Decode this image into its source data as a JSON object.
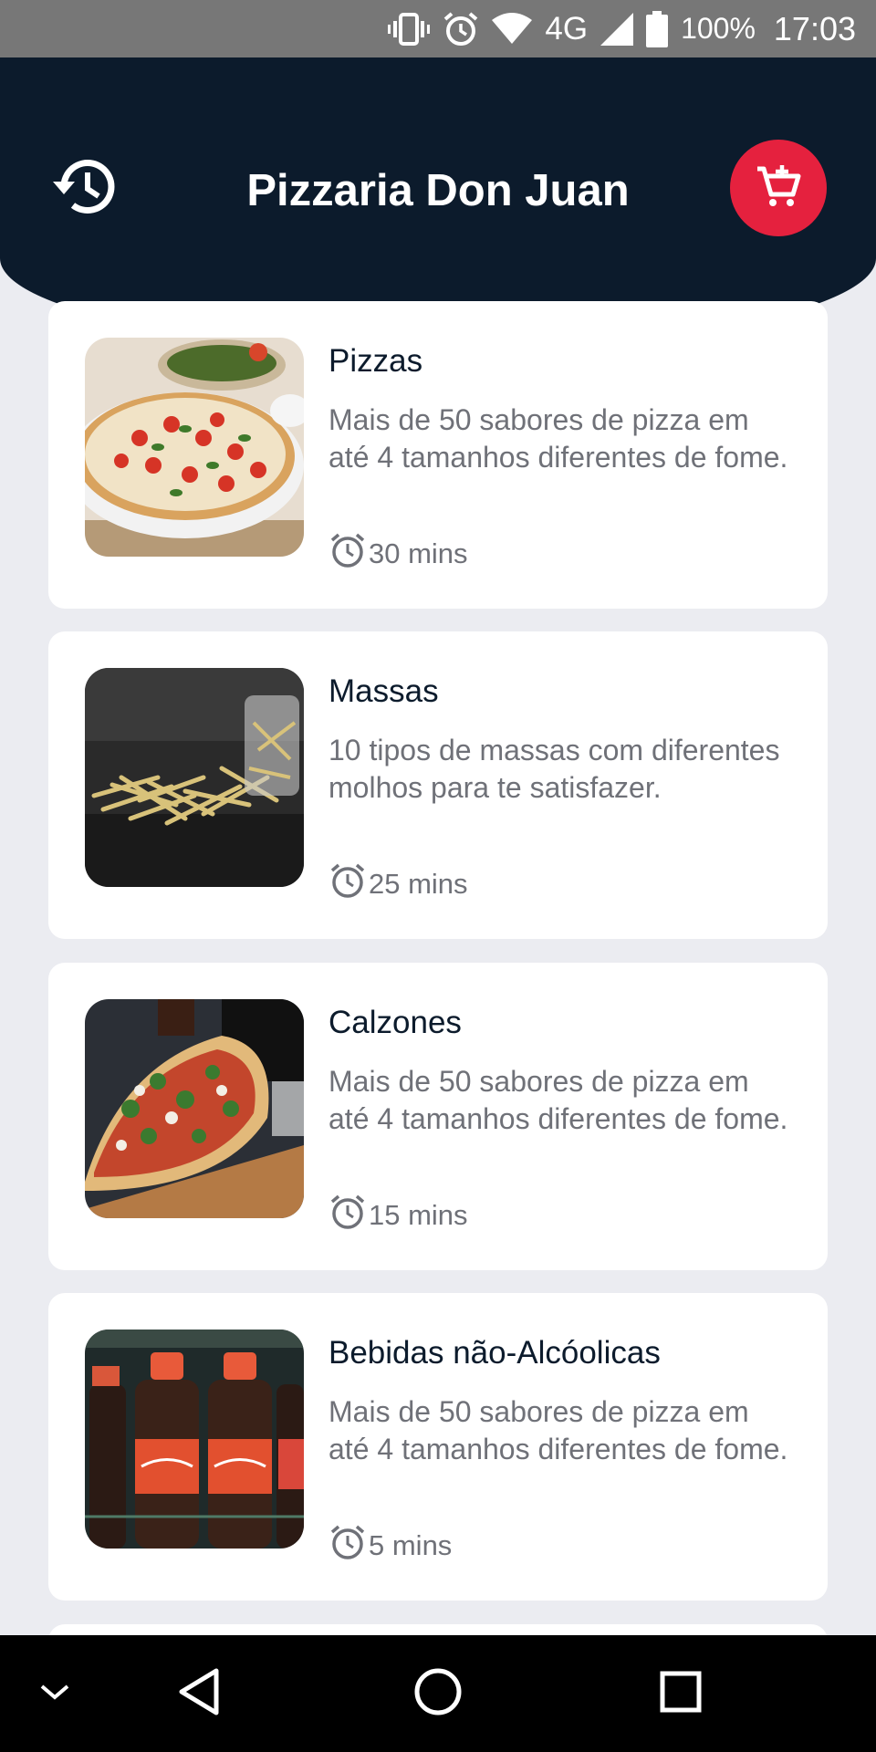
{
  "status_bar": {
    "icons": [
      "vibrate-icon",
      "alarm-icon",
      "wifi-icon",
      "network-icon",
      "signal-icon",
      "battery-icon"
    ],
    "network": "4G",
    "battery": "100%",
    "time": "17:03"
  },
  "header": {
    "title": "Pizzaria Don Juan",
    "history_icon": "history-icon",
    "cart_icon": "add-shopping-cart-icon"
  },
  "colors": {
    "header_bg": "#0c1b2c",
    "accent": "#e5213e",
    "page_bg": "#ebecf1",
    "card_bg": "#ffffff",
    "text_primary": "#0c1b2c",
    "text_secondary": "#6f7178"
  },
  "categories": [
    {
      "title": "Pizzas",
      "description": "Mais de 50 sabores de pizza em até 4 tamanhos diferentes de fome.",
      "time": "30 mins",
      "image": "pizza-photo"
    },
    {
      "title": "Massas",
      "description": "10 tipos de massas com diferentes molhos para te satisfazer.",
      "time": "25 mins",
      "image": "pasta-photo"
    },
    {
      "title": "Calzones",
      "description": "Mais de 50 sabores de pizza em até 4 tamanhos diferentes de fome.",
      "time": "15 mins",
      "image": "calzone-photo"
    },
    {
      "title": "Bebidas não-Alcóolicas",
      "description": "Mais de 50 sabores de pizza em até 4 tamanhos diferentes de fome.",
      "time": "5 mins",
      "image": "soda-bottles-photo"
    }
  ],
  "nav_bar": {
    "icons": [
      "chevron-down-icon",
      "back-icon",
      "home-icon",
      "recents-icon"
    ]
  }
}
